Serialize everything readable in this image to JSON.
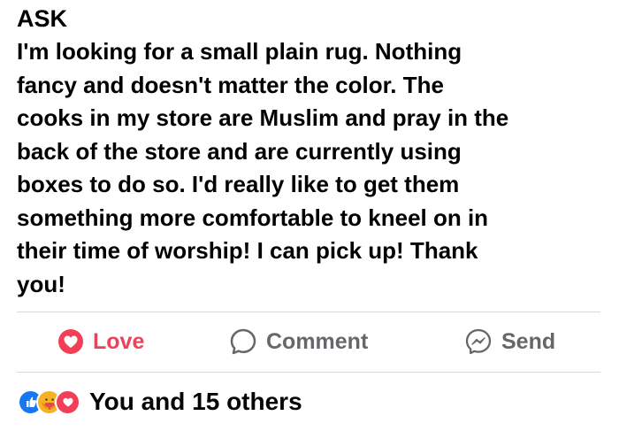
{
  "post": {
    "tag": "ASK",
    "body_lines": [
      "I'm looking for a small plain rug. Nothing",
      "fancy and doesn't matter the color. The",
      "cooks in my store are Muslim and pray in the",
      "back of the store and are currently using",
      "boxes to do so. I'd really like to get them",
      "something more comfortable to kneel on in",
      "their time of worship! I can pick up! Thank",
      "you!"
    ]
  },
  "actions": {
    "love_label": "Love",
    "comment_label": "Comment",
    "send_label": "Send"
  },
  "reactions": {
    "summary": "You and 15 others",
    "icons": [
      "like-reaction-icon",
      "care-reaction-icon",
      "love-reaction-icon"
    ]
  },
  "colors": {
    "love": "#f33e58",
    "like": "#1877f2",
    "care": "#f7b125",
    "muted": "#65676b"
  }
}
